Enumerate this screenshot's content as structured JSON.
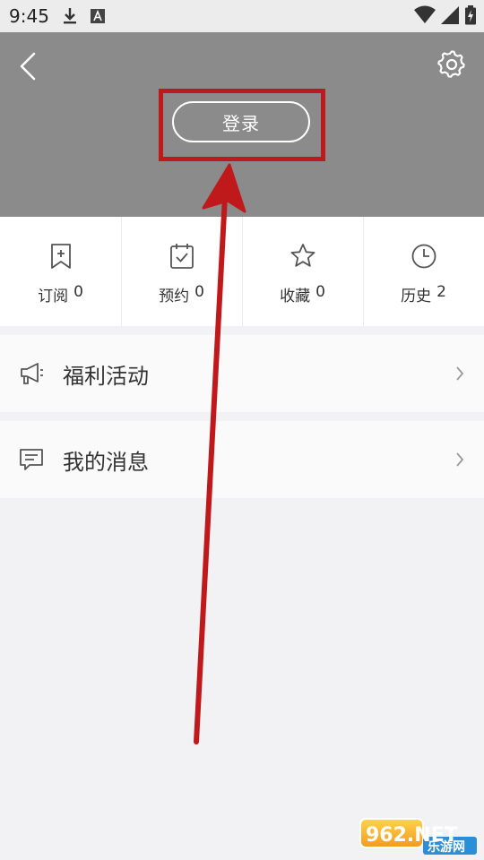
{
  "status_bar": {
    "time": "9:45",
    "icons": [
      "download-icon",
      "a-icon",
      "wifi-icon",
      "signal-icon",
      "battery-icon"
    ]
  },
  "header": {
    "login_label": "登录",
    "icons": [
      "back-icon",
      "gear-icon"
    ]
  },
  "stats": [
    {
      "label": "订阅",
      "count": "0",
      "icon": "bookmark-plus-icon"
    },
    {
      "label": "预约",
      "count": "0",
      "icon": "calendar-check-icon"
    },
    {
      "label": "收藏",
      "count": "0",
      "icon": "star-icon"
    },
    {
      "label": "历史",
      "count": "2",
      "icon": "clock-icon"
    }
  ],
  "menu": [
    {
      "label": "福利活动",
      "icon": "megaphone-icon"
    },
    {
      "label": "我的消息",
      "icon": "message-icon"
    }
  ],
  "watermark": {
    "brand": "962.NET",
    "caption": "乐游网"
  },
  "colors": {
    "header_bg": "#8b8b8b",
    "highlight": "#c0191b",
    "page_bg": "#f2f2f4"
  }
}
